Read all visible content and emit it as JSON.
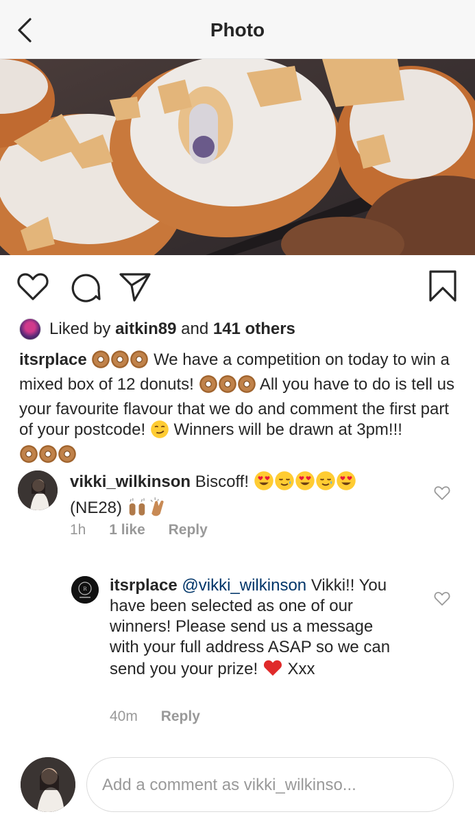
{
  "header": {
    "title": "Photo",
    "back_icon": "chevron-left-icon"
  },
  "likes": {
    "prefix": "Liked by",
    "user": "aitkin89",
    "middle": "and",
    "count": "141 others"
  },
  "caption": {
    "user": "itsrplace",
    "part1": "We have a competition on today to win a mixed box of 12 donuts!",
    "part2": "All you have to do is tell us your favourite flavour that we do and comment the first part of your postcode!",
    "part3": "Winners will be drawn at 3pm!!!"
  },
  "comments": [
    {
      "user": "vikki_wilkinson",
      "text1": "Biscoff!",
      "text2": "(NE28)",
      "time": "1h",
      "likes": "1 like",
      "reply": "Reply"
    },
    {
      "user": "itsrplace",
      "mention": "@vikki_wilkinson",
      "text": "Vikki!! You have been selected as one of our winners! Please send us a message with your full address ASAP so we can send you your prize!",
      "text_end": "Xxx",
      "time": "40m",
      "reply": "Reply"
    }
  ],
  "composer": {
    "placeholder": "Add a comment as vikki_wilkinso..."
  },
  "colors": {
    "header_bg": "#f7f7f7",
    "text": "#262626",
    "meta": "#999999",
    "mention": "#003569"
  }
}
